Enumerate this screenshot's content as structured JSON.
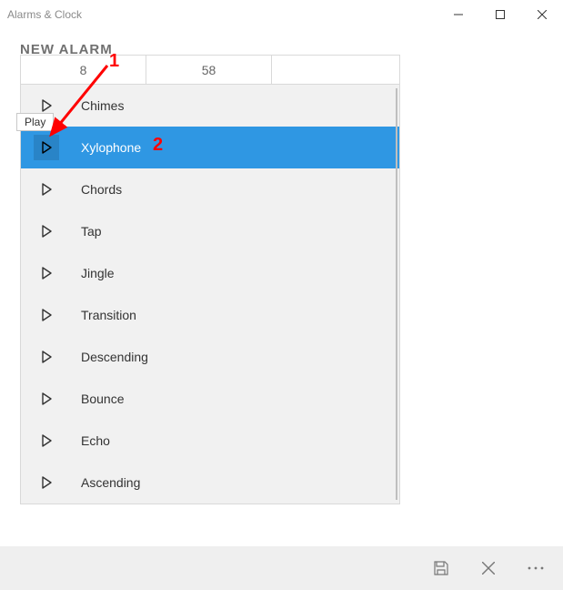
{
  "window": {
    "title": "Alarms & Clock"
  },
  "heading": "NEW ALARM",
  "time": {
    "hour": "8",
    "minute": "58"
  },
  "tooltip": "Play",
  "sounds": {
    "items": [
      {
        "label": "Chimes"
      },
      {
        "label": "Xylophone"
      },
      {
        "label": "Chords"
      },
      {
        "label": "Tap"
      },
      {
        "label": "Jingle"
      },
      {
        "label": "Transition"
      },
      {
        "label": "Descending"
      },
      {
        "label": "Bounce"
      },
      {
        "label": "Echo"
      },
      {
        "label": "Ascending"
      }
    ],
    "selected_index": 1
  },
  "annotations": {
    "one": "1",
    "two": "2"
  },
  "icons": {
    "play": "play-icon",
    "minimize": "minimize-icon",
    "maximize": "maximize-icon",
    "close": "close-icon",
    "save": "save-icon",
    "cancel": "cancel-icon",
    "more": "more-icon"
  }
}
